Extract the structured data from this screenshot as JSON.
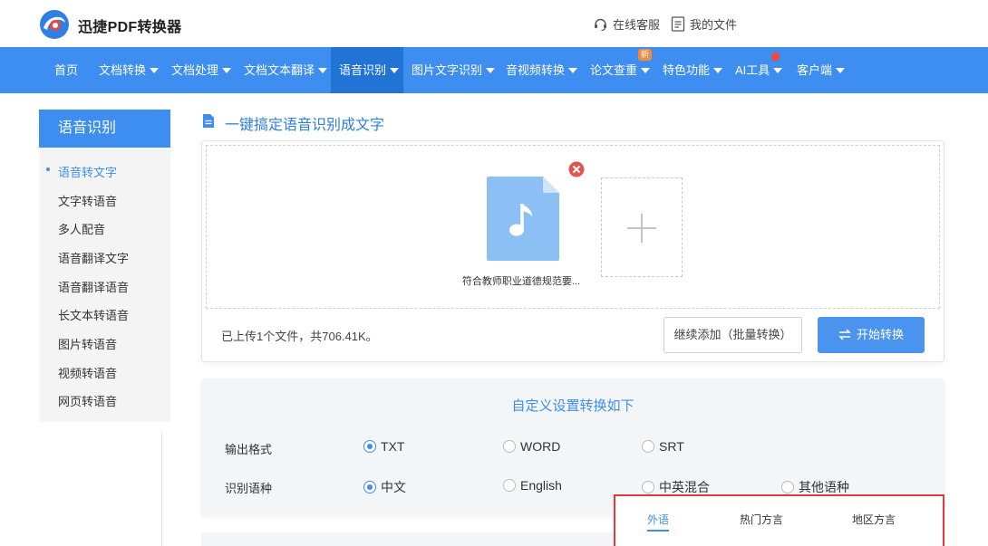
{
  "header": {
    "brand": "迅捷PDF转换器",
    "service_link": "在线客服",
    "files_link": "我的文件"
  },
  "nav": {
    "items": [
      {
        "label": "首页"
      },
      {
        "label": "文档转换"
      },
      {
        "label": "文档处理"
      },
      {
        "label": "文档文本翻译"
      },
      {
        "label": "语音识别"
      },
      {
        "label": "图片文字识别"
      },
      {
        "label": "音视频转换"
      },
      {
        "label": "论文查重"
      },
      {
        "label": "特色功能"
      },
      {
        "label": "AI工具"
      },
      {
        "label": "客户端"
      }
    ],
    "active_index": 4,
    "new_badge": "新"
  },
  "sidebar": {
    "title": "语音识别",
    "items": [
      {
        "label": "语音转文字"
      },
      {
        "label": "文字转语音"
      },
      {
        "label": "多人配音"
      },
      {
        "label": "语音翻译文字"
      },
      {
        "label": "语音翻译语音"
      },
      {
        "label": "长文本转语音"
      },
      {
        "label": "图片转语音"
      },
      {
        "label": "视频转语音"
      },
      {
        "label": "网页转语音"
      }
    ],
    "active_index": 0
  },
  "main": {
    "title": "一键搞定语音识别成文字",
    "file": {
      "name": "符合教师职业道德规范要...",
      "icon": "music-file-icon"
    },
    "upload_status": "已上传1个文件，共706.41K。",
    "continue_button": "继续添加（批量转换）",
    "start_button": "开始转换"
  },
  "settings": {
    "title": "自定义设置转换如下",
    "output_format": {
      "label": "输出格式",
      "options": [
        "TXT",
        "WORD",
        "SRT"
      ],
      "selected": "TXT"
    },
    "language": {
      "label": "识别语种",
      "options": [
        "中文",
        "English",
        "中英混合",
        "其他语种"
      ],
      "selected": "中文"
    }
  },
  "language_popup": {
    "tabs": [
      "外语",
      "热门方言",
      "地区方言"
    ],
    "active_tab": "外语"
  },
  "colors": {
    "accent": "#3d8ef0",
    "nav_active": "#2273d6",
    "highlight_border": "#e0393e",
    "remove": "#e5554f"
  }
}
